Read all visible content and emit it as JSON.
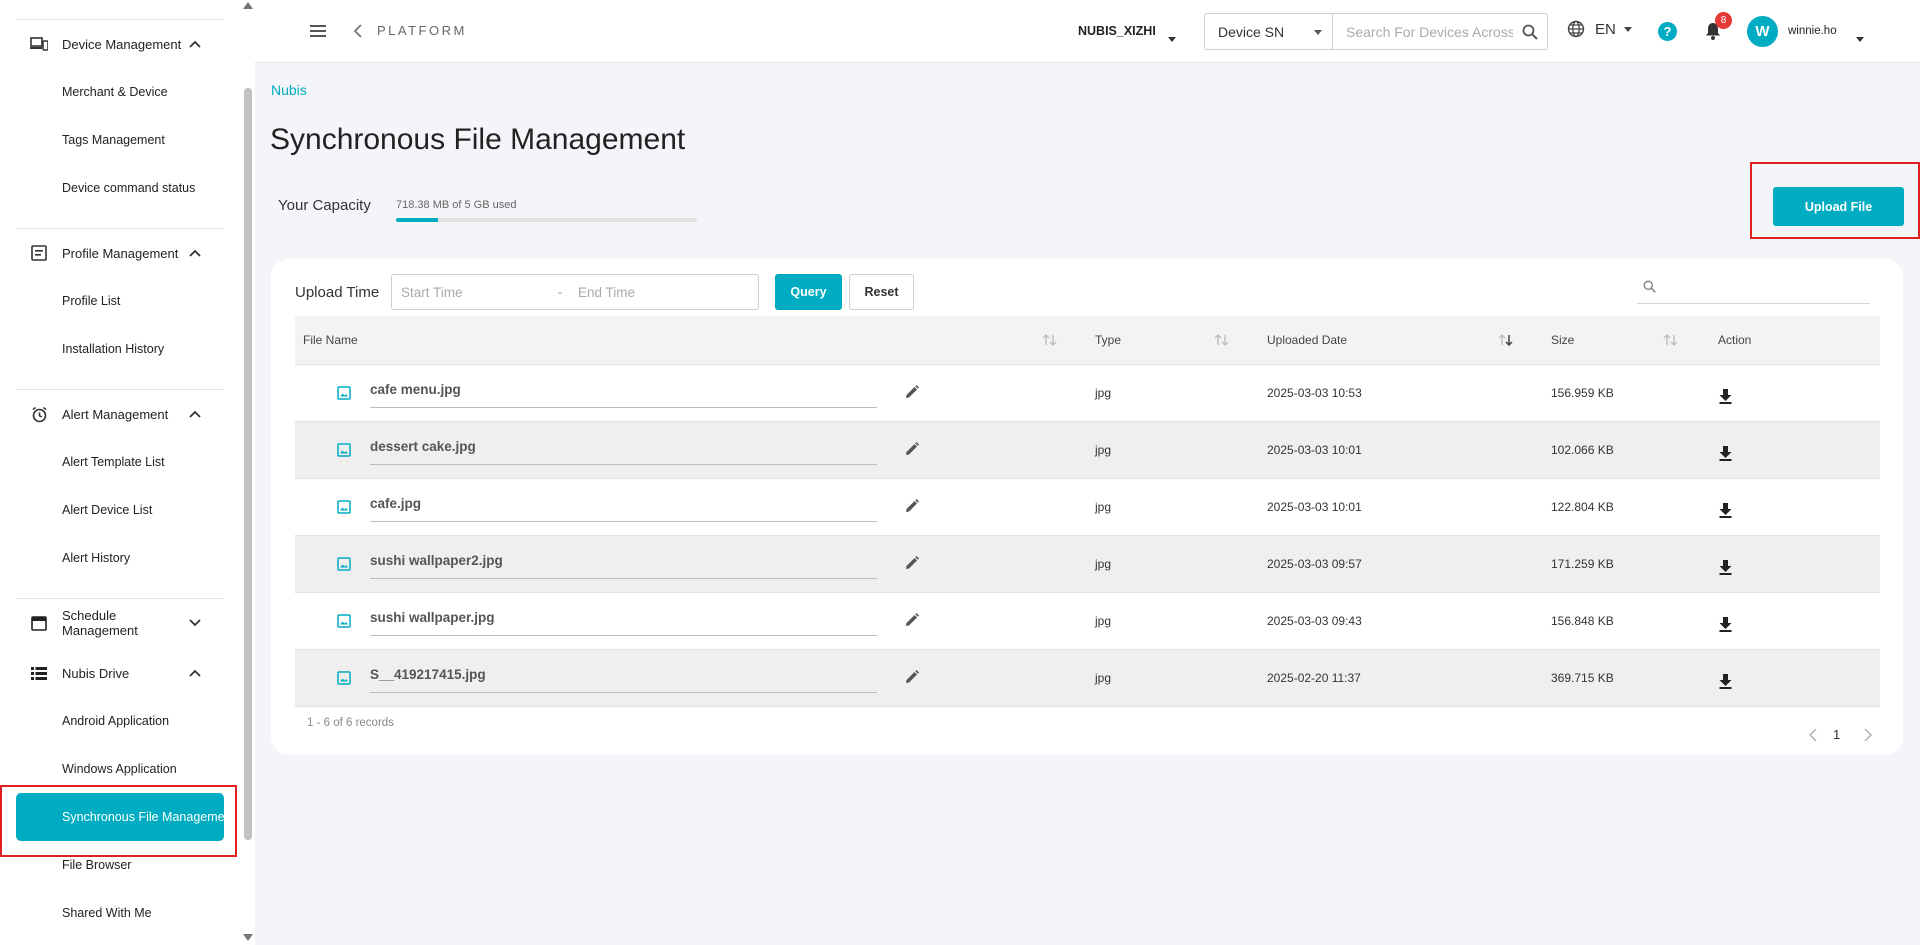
{
  "sidebar": {
    "groups": [
      {
        "label": "Device Management",
        "icon": "devices-icon",
        "expanded": true
      },
      {
        "label": "Profile Management",
        "icon": "profile-icon",
        "expanded": true
      },
      {
        "label": "Alert Management",
        "icon": "alarm-clock-icon",
        "expanded": true
      },
      {
        "label": "Schedule Management",
        "icon": "calendar-icon",
        "expanded": false
      },
      {
        "label": "Nubis Drive",
        "icon": "list-icon",
        "expanded": true
      }
    ],
    "items": {
      "merchant_device": "Merchant & Device",
      "tags_management": "Tags Management",
      "device_command_status": "Device command status",
      "profile_list": "Profile List",
      "installation_history": "Installation History",
      "alert_template_list": "Alert Template List",
      "alert_device_list": "Alert Device List",
      "alert_history": "Alert History",
      "android_application": "Android Application",
      "windows_application": "Windows Application",
      "synchronous_file_management": "Synchronous File Managemen",
      "file_browser": "File Browser",
      "shared_with_me": "Shared With Me"
    }
  },
  "header": {
    "platform": "PLATFORM",
    "merchant": "NUBIS_XIZHI",
    "search_type": "Device SN",
    "search_placeholder": "Search For Devices Across",
    "language": "EN",
    "help": "?",
    "notification_count": "8",
    "avatar_letter": "W",
    "username": "winnie.ho"
  },
  "breadcrumb": "Nubis",
  "page_title": "Synchronous File Management",
  "capacity": {
    "label": "Your Capacity",
    "text": "718.38 MB of 5 GB used",
    "used_fraction": 0.14
  },
  "upload_button": "Upload File",
  "filter": {
    "label": "Upload Time",
    "start_placeholder": "Start Time",
    "separator": "-",
    "end_placeholder": "End Time",
    "query": "Query",
    "reset": "Reset"
  },
  "table": {
    "headers": {
      "file_name": "File Name",
      "type": "Type",
      "uploaded_date": "Uploaded Date",
      "size": "Size",
      "action": "Action"
    },
    "rows": [
      {
        "name": "cafe menu.jpg",
        "type": "jpg",
        "date": "2025-03-03 10:53",
        "size": "156.959 KB"
      },
      {
        "name": "dessert cake.jpg",
        "type": "jpg",
        "date": "2025-03-03 10:01",
        "size": "102.066 KB"
      },
      {
        "name": "cafe.jpg",
        "type": "jpg",
        "date": "2025-03-03 10:01",
        "size": "122.804 KB"
      },
      {
        "name": "sushi wallpaper2.jpg",
        "type": "jpg",
        "date": "2025-03-03 09:57",
        "size": "171.259 KB"
      },
      {
        "name": "sushi wallpaper.jpg",
        "type": "jpg",
        "date": "2025-03-03 09:43",
        "size": "156.848 KB"
      },
      {
        "name": "S__419217415.jpg",
        "type": "jpg",
        "date": "2025-02-20 11:37",
        "size": "369.715 KB"
      }
    ]
  },
  "pagination": {
    "records": "1 - 6 of 6 records",
    "current_page": "1"
  },
  "colors": {
    "accent": "#00acc1",
    "highlight": "#e02020",
    "badge": "#e53935"
  }
}
